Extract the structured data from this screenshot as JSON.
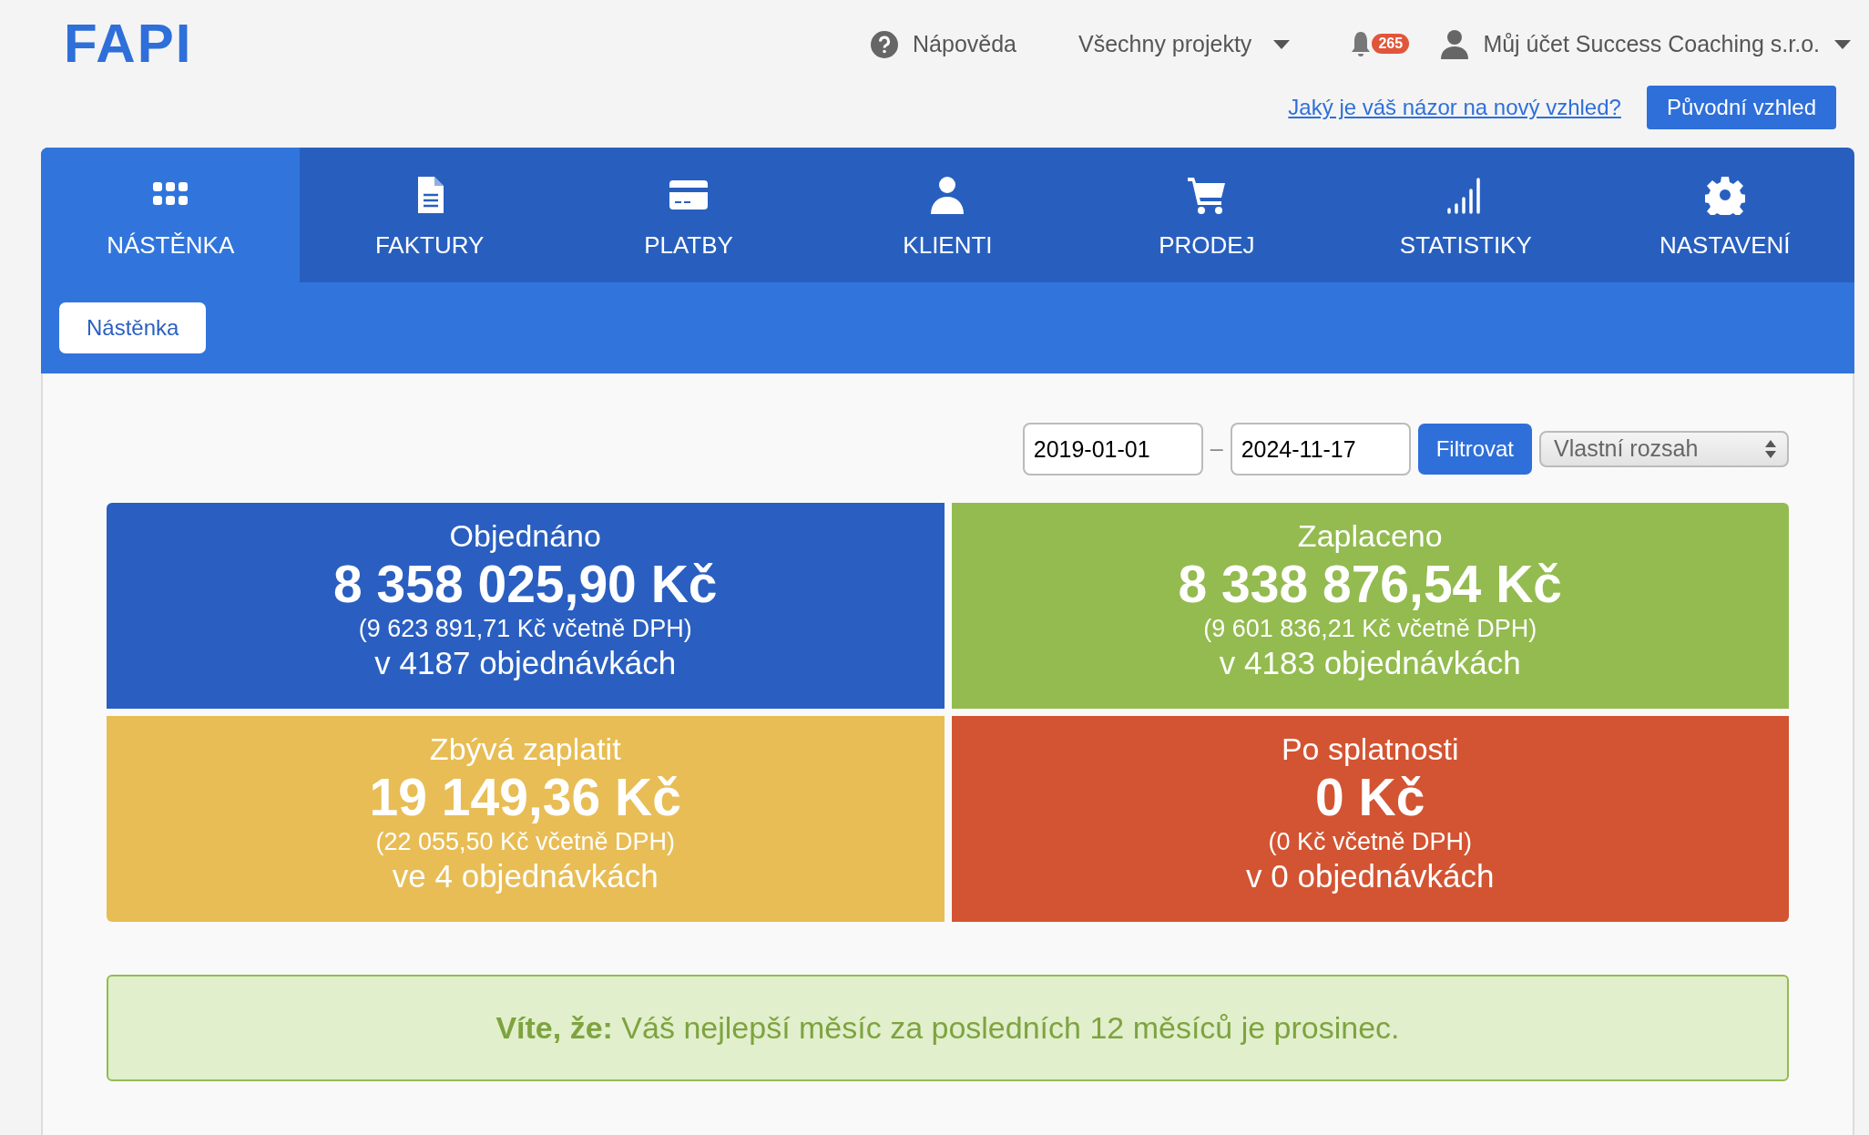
{
  "logo": "FAPI",
  "header": {
    "help": "Nápověda",
    "projects": "Všechny projekty",
    "notifications": "265",
    "account": "Můj účet Success Coaching s.r.o.",
    "feedback_link": "Jaký je váš názor na nový vzhled?",
    "old_look_button": "Původní vzhled"
  },
  "tabs": [
    {
      "label": "NÁSTĚNKA",
      "kind": "grid",
      "selected": true
    },
    {
      "label": "FAKTURY",
      "kind": "file",
      "selected": false
    },
    {
      "label": "PLATBY",
      "kind": "card",
      "selected": false
    },
    {
      "label": "KLIENTI",
      "kind": "user",
      "selected": false
    },
    {
      "label": "PRODEJ",
      "kind": "cart",
      "selected": false
    },
    {
      "label": "STATISTIKY",
      "kind": "bars",
      "selected": false
    },
    {
      "label": "NASTAVENÍ",
      "kind": "gear",
      "selected": false
    }
  ],
  "subnav": [
    {
      "label": "Nástěnka",
      "selected": true
    }
  ],
  "filter": {
    "date_from": "2019-01-01",
    "separator": "–",
    "date_to": "2024-11-17",
    "button": "Filtrovat",
    "range": "Vlastní rozsah"
  },
  "cards": [
    {
      "title": "Objednáno",
      "amount": "8 358 025,90 Kč",
      "vat": "(9 623 891,71 Kč včetně DPH)",
      "orders": "v 4187 objednávkách",
      "color": "#2a5fc1"
    },
    {
      "title": "Zaplaceno",
      "amount": "8 338 876,54 Kč",
      "vat": "(9 601 836,21 Kč včetně DPH)",
      "orders": "v 4183 objednávkách",
      "color": "#93bb4f"
    },
    {
      "title": "Zbývá zaplatit",
      "amount": "19 149,36 Kč",
      "vat": "(22 055,50 Kč včetně DPH)",
      "orders": "ve 4 objednávkách",
      "color": "#e8bd55"
    },
    {
      "title": "Po splatnosti",
      "amount": "0 Kč",
      "vat": "(0 Kč včetně DPH)",
      "orders": "v 0 objednávkách",
      "color": "#d35432"
    }
  ],
  "tip": "**Víte, že:** Váš nejlepší měsíc za posledních 12 měsíců je prosinec."
}
